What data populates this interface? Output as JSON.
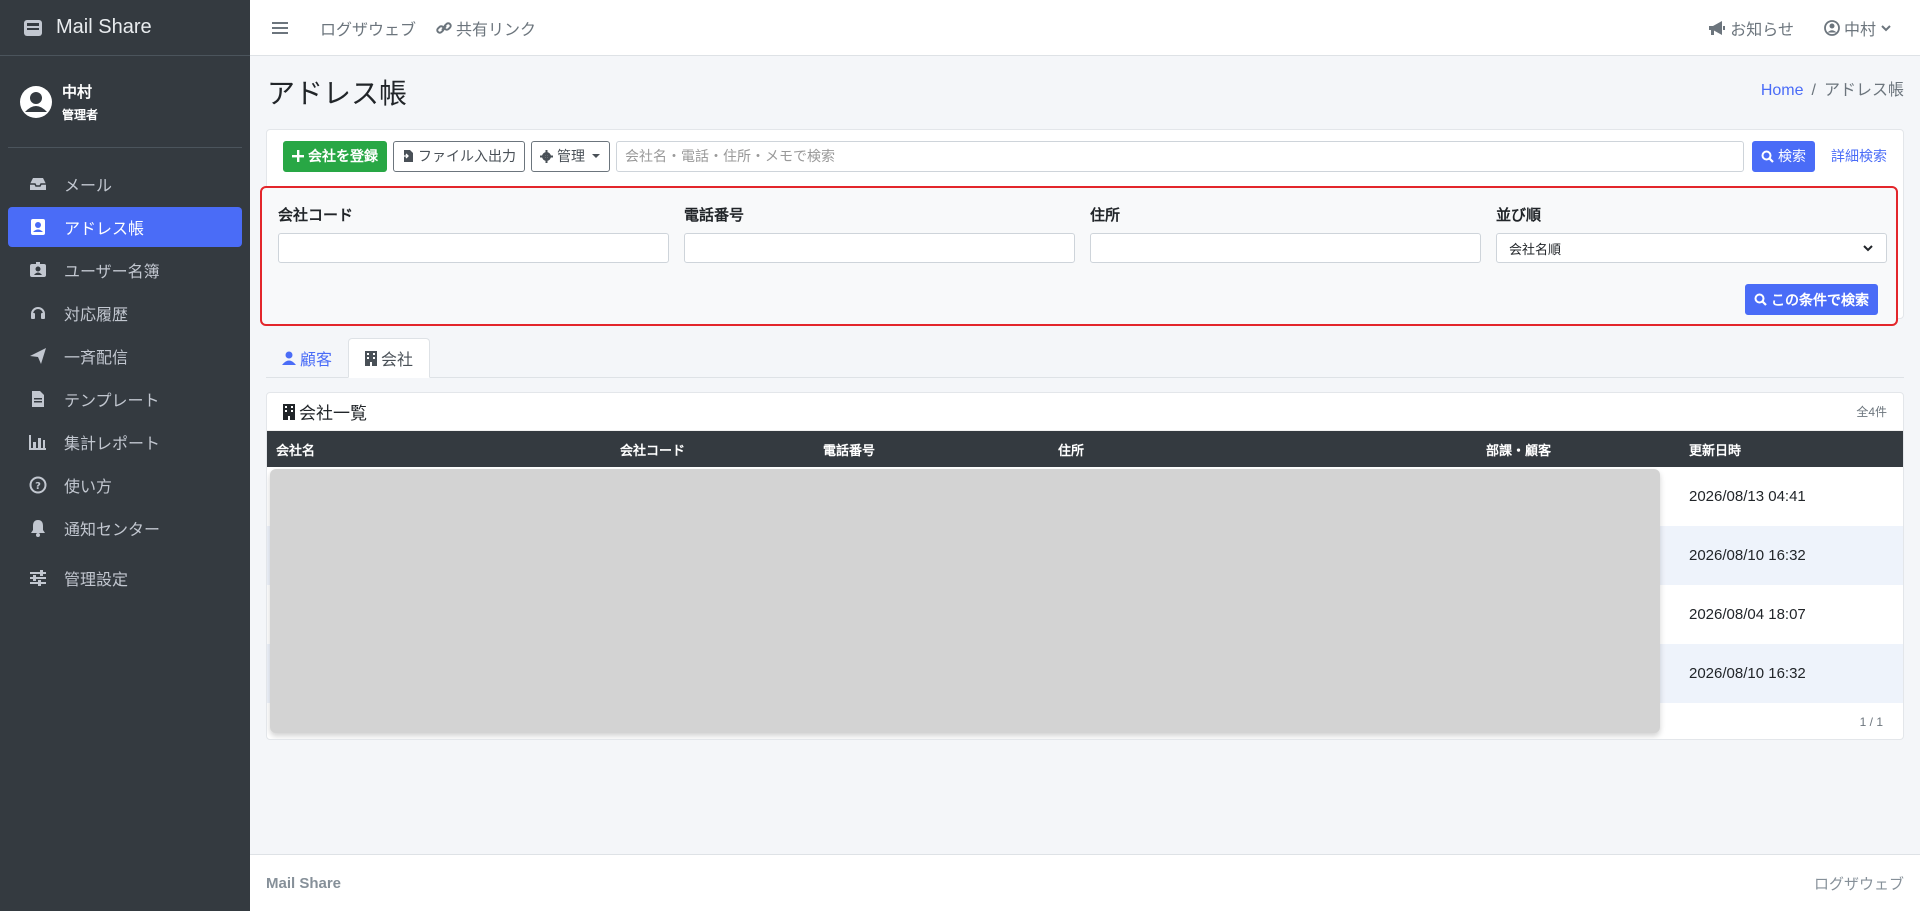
{
  "brand": {
    "name": "Mail Share"
  },
  "user": {
    "name": "中村",
    "role": "管理者"
  },
  "sidebar": {
    "items": [
      {
        "label": "メール",
        "icon": "inbox-icon"
      },
      {
        "label": "アドレス帳",
        "icon": "address-book-icon",
        "active": true
      },
      {
        "label": "ユーザー名簿",
        "icon": "id-badge-icon"
      },
      {
        "label": "対応履歴",
        "icon": "headset-icon"
      },
      {
        "label": "一斉配信",
        "icon": "paper-plane-icon"
      },
      {
        "label": "テンプレート",
        "icon": "file-icon"
      },
      {
        "label": "集計レポート",
        "icon": "bar-chart-icon"
      },
      {
        "label": "使い方",
        "icon": "question-circle-icon"
      },
      {
        "label": "通知センター",
        "icon": "bell-icon"
      },
      {
        "label": "管理設定",
        "icon": "sliders-icon"
      }
    ]
  },
  "topbar": {
    "link1": "ログザウェブ",
    "link2": "共有リンク",
    "notice": "お知らせ",
    "user": "中村"
  },
  "page": {
    "title": "アドレス帳",
    "breadcrumb_home": "Home",
    "breadcrumb_sep": "/",
    "breadcrumb_current": "アドレス帳"
  },
  "toolbar": {
    "register": "会社を登録",
    "file_io": "ファイル入出力",
    "manage": "管理",
    "search_placeholder": "会社名・電話・住所・メモで検索",
    "search": "検索",
    "advanced": "詳細検索"
  },
  "advanced": {
    "company_code_label": "会社コード",
    "company_code_value": "",
    "phone_label": "電話番号",
    "phone_value": "",
    "address_label": "住所",
    "address_value": "",
    "sort_label": "並び順",
    "sort_value": "会社名順",
    "submit": "この条件で検索"
  },
  "tabs": {
    "customer": "顧客",
    "company": "会社"
  },
  "list": {
    "title": "会社一覧",
    "count": "全4件",
    "columns": [
      "会社名",
      "会社コード",
      "電話番号",
      "住所",
      "部課・顧客",
      "更新日時"
    ],
    "rows": [
      {
        "updated": "2026/08/13 04:41"
      },
      {
        "updated": "2026/08/10 16:32"
      },
      {
        "updated": "2026/08/04 18:07"
      },
      {
        "updated": "2026/08/10 16:32"
      }
    ],
    "pager": "1 / 1"
  },
  "footer": {
    "left": "Mail Share",
    "right": "ログザウェブ"
  },
  "colors": {
    "primary": "#4a6cf7",
    "success": "#28a745",
    "sidebar": "#343a40",
    "highlight": "#e3262b"
  }
}
